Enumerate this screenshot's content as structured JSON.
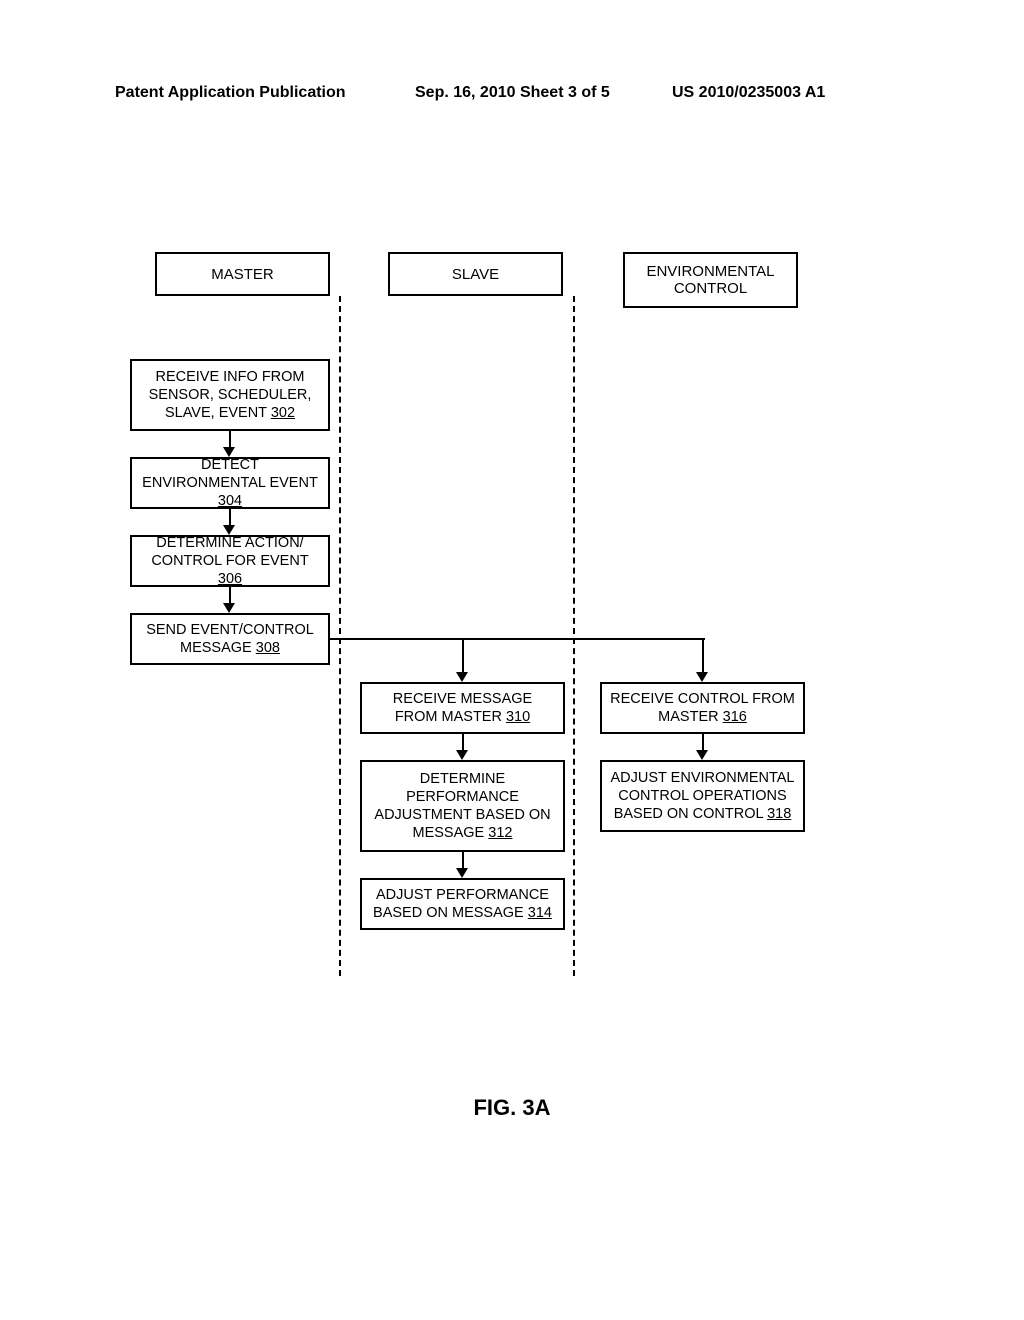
{
  "header": {
    "left": "Patent Application Publication",
    "center": "Sep. 16, 2010  Sheet 3 of 5",
    "right": "US 2010/0235003 A1"
  },
  "lanes": {
    "master": "MASTER",
    "slave": "SLAVE",
    "env": "ENVIRONMENTAL CONTROL"
  },
  "steps": {
    "s302": {
      "t": "RECEIVE INFO FROM SENSOR, SCHEDULER, SLAVE, EVENT ",
      "r": "302"
    },
    "s304": {
      "t": "DETECT ENVIRONMENTAL EVENT ",
      "r": "304"
    },
    "s306": {
      "t": "DETERMINE ACTION/ CONTROL FOR EVENT ",
      "r": "306"
    },
    "s308": {
      "t": "SEND EVENT/CONTROL MESSAGE ",
      "r": "308"
    },
    "s310": {
      "t": "RECEIVE MESSAGE FROM MASTER ",
      "r": "310"
    },
    "s312": {
      "t": "DETERMINE PERFORMANCE ADJUSTMENT BASED ON MESSAGE ",
      "r": "312"
    },
    "s314": {
      "t": "ADJUST PERFORMANCE BASED ON MESSAGE ",
      "r": "314"
    },
    "s316": {
      "t": "RECEIVE CONTROL FROM MASTER ",
      "r": "316"
    },
    "s318": {
      "t": "ADJUST ENVIRONMENTAL CONTROL OPERATIONS BASED ON CONTROL ",
      "r": "318"
    }
  },
  "figure": "FIG. 3A"
}
